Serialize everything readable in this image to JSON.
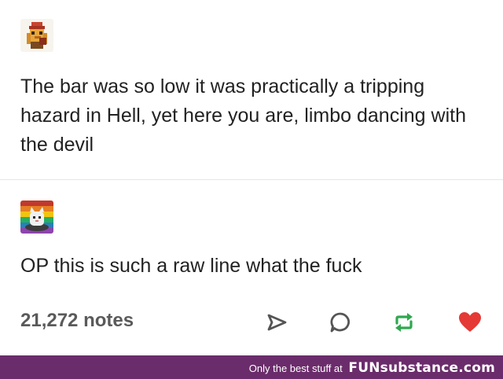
{
  "post": {
    "original_text": "The bar was so low it was practically a tripping hazard in Hell, yet here you are, limbo dancing with the devil",
    "reply_text": "OP this is such a raw line what the fuck"
  },
  "footer": {
    "notes": "21,272 notes",
    "actions": [
      "share-icon",
      "reply-icon",
      "reblog-icon",
      "like-icon"
    ],
    "colors": {
      "reblog": "#2fa84f",
      "like": "#e53935"
    }
  },
  "banner": {
    "tagline": "Only the best stuff at",
    "brand": "FUNsubstance.com",
    "color": "#6b2c6b"
  }
}
